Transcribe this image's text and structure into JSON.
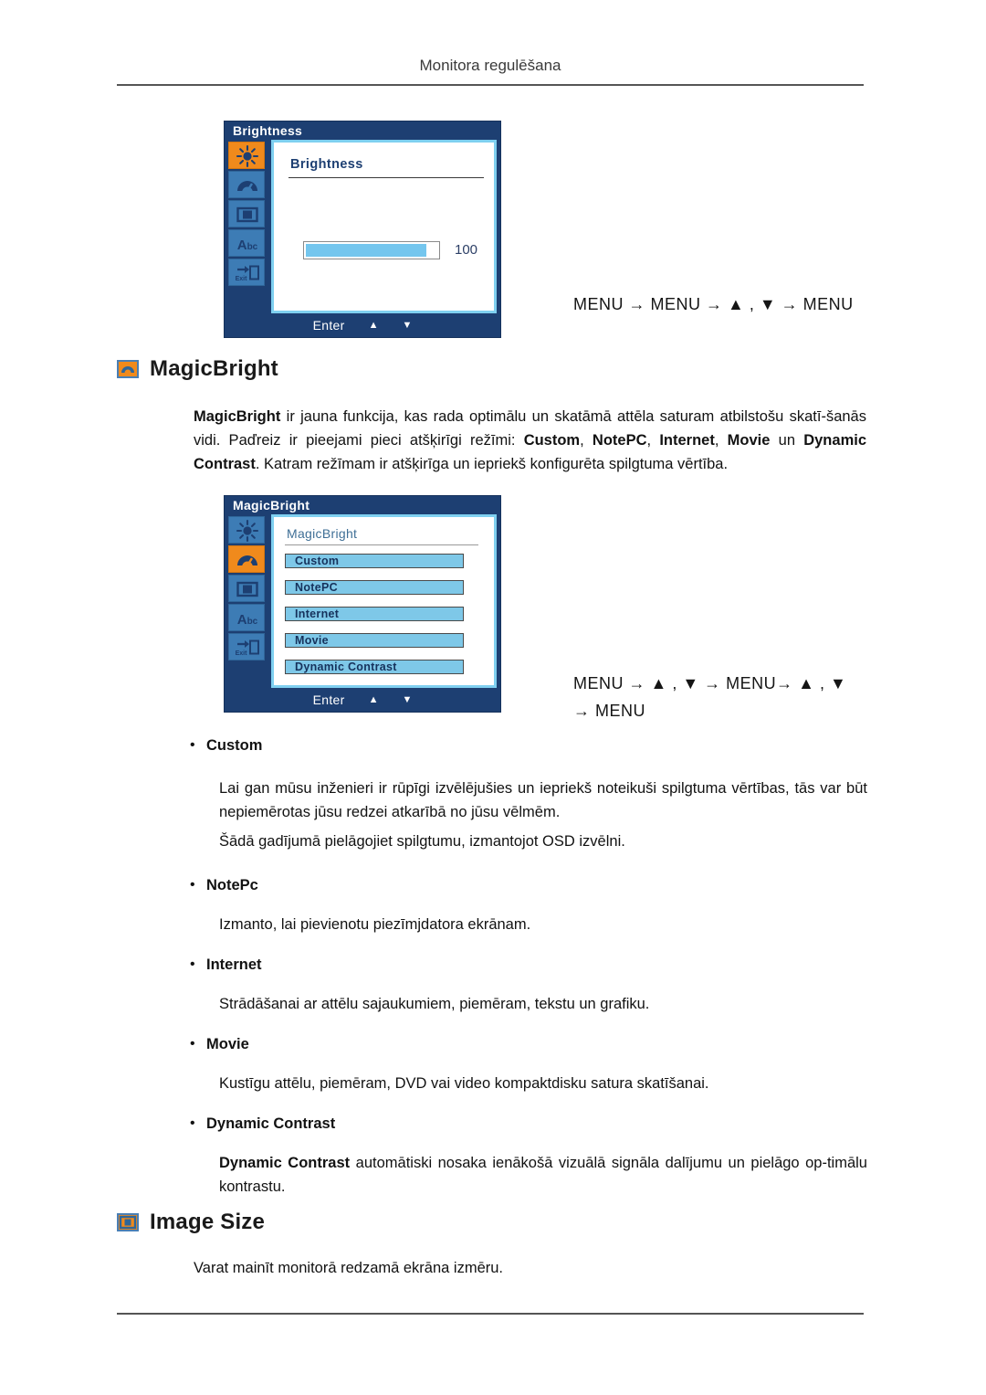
{
  "page": {
    "header": "Monitora regulēšana"
  },
  "brightness_osd": {
    "title": "Brightness",
    "screen_label": "Brightness",
    "value": "100",
    "fill_percent": 92,
    "footer": {
      "enter": "Enter",
      "up": "▲",
      "down": "▼"
    },
    "rail": [
      {
        "name": "brightness-icon",
        "active": true
      },
      {
        "name": "magicbright-gauge-icon",
        "active": false
      },
      {
        "name": "image-size-icon",
        "active": false
      },
      {
        "name": "osd-abc-icon",
        "active": false
      },
      {
        "name": "exit-icon",
        "active": false
      }
    ]
  },
  "brightness_nav": "MENU → MENU → ▲ , ▼ → MENU",
  "magicbright_section": {
    "heading": "MagicBright",
    "paragraph_parts": [
      {
        "text": "MagicBright",
        "bold": true
      },
      {
        "text": " ir jauna funkcija, kas rada optimālu un skatāmā attēla saturam atbilstošu skatī-šanās vidi. Paďreiz ir pieejami pieci atšķirīgi režīmi: ",
        "bold": false
      },
      {
        "text": "Custom",
        "bold": true
      },
      {
        "text": ", ",
        "bold": false
      },
      {
        "text": "NotePC",
        "bold": true
      },
      {
        "text": ", ",
        "bold": false
      },
      {
        "text": "Internet",
        "bold": true
      },
      {
        "text": ", ",
        "bold": false
      },
      {
        "text": "Movie",
        "bold": true
      },
      {
        "text": " un ",
        "bold": false
      },
      {
        "text": "Dynamic Contrast",
        "bold": true
      },
      {
        "text": ". Katram režīmam ir atšķirīga un iepriekš konfigurēta spilgtuma vērtība.",
        "bold": false
      }
    ]
  },
  "magicbright_osd": {
    "title": "MagicBright",
    "screen_label": "MagicBright",
    "options": [
      "Custom",
      "NotePC",
      "Internet",
      "Movie",
      "Dynamic Contrast"
    ],
    "footer": {
      "enter": "Enter",
      "up": "▲",
      "down": "▼"
    },
    "rail": [
      {
        "name": "brightness-icon",
        "active": false
      },
      {
        "name": "magicbright-gauge-icon",
        "active": true
      },
      {
        "name": "image-size-icon",
        "active": false
      },
      {
        "name": "osd-abc-icon",
        "active": false
      },
      {
        "name": "exit-icon",
        "active": false
      }
    ]
  },
  "magicbright_nav": "MENU → ▲ , ▼ → MENU→ ▲ , ▼ → MENU",
  "modes": [
    {
      "label": "Custom",
      "paragraphs": [
        "Lai gan mūsu inženieri ir rūpīgi izvēlējušies un iepriekš noteikuši spilgtuma vērtības, tās var būt nepiemērotas jūsu redzei atkarībā no jūsu vēlmēm.",
        "Šādā gadījumā pielāgojiet spilgtumu, izmantojot OSD izvēlni."
      ]
    },
    {
      "label": "NotePc",
      "paragraphs": [
        "Izmanto, lai pievienotu piezīmjdatora ekrānam."
      ]
    },
    {
      "label": "Internet",
      "paragraphs": [
        "Strādāšanai ar attēlu sajaukumiem, piemēram, tekstu un grafiku."
      ]
    },
    {
      "label": "Movie",
      "paragraphs": [
        "Kustīgu attēlu, piemēram, DVD vai video kompaktdisku satura skatīšanai."
      ]
    },
    {
      "label": "Dynamic Contrast",
      "paragraphs": []
    }
  ],
  "dynamic_contrast_paragraph_parts": [
    {
      "text": "Dynamic Contrast",
      "bold": true
    },
    {
      "text": " automātiski nosaka ienākošā vizuālā signāla dalījumu un pielāgo op-timālu kontrastu.",
      "bold": false
    }
  ],
  "image_size_section": {
    "heading": "Image Size",
    "paragraph": "Varat mainīt monitorā redzamā ekrāna izmēru."
  },
  "bullet_char": "•",
  "colors": {
    "osd_navy": "#1d3f72",
    "osd_rail_blue": "#3d7cb5",
    "accent_orange": "#f08a1c",
    "osd_screen_border": "#7fd0f0",
    "option_blue": "#7ec8e8",
    "slider_blue": "#74c6ee"
  }
}
